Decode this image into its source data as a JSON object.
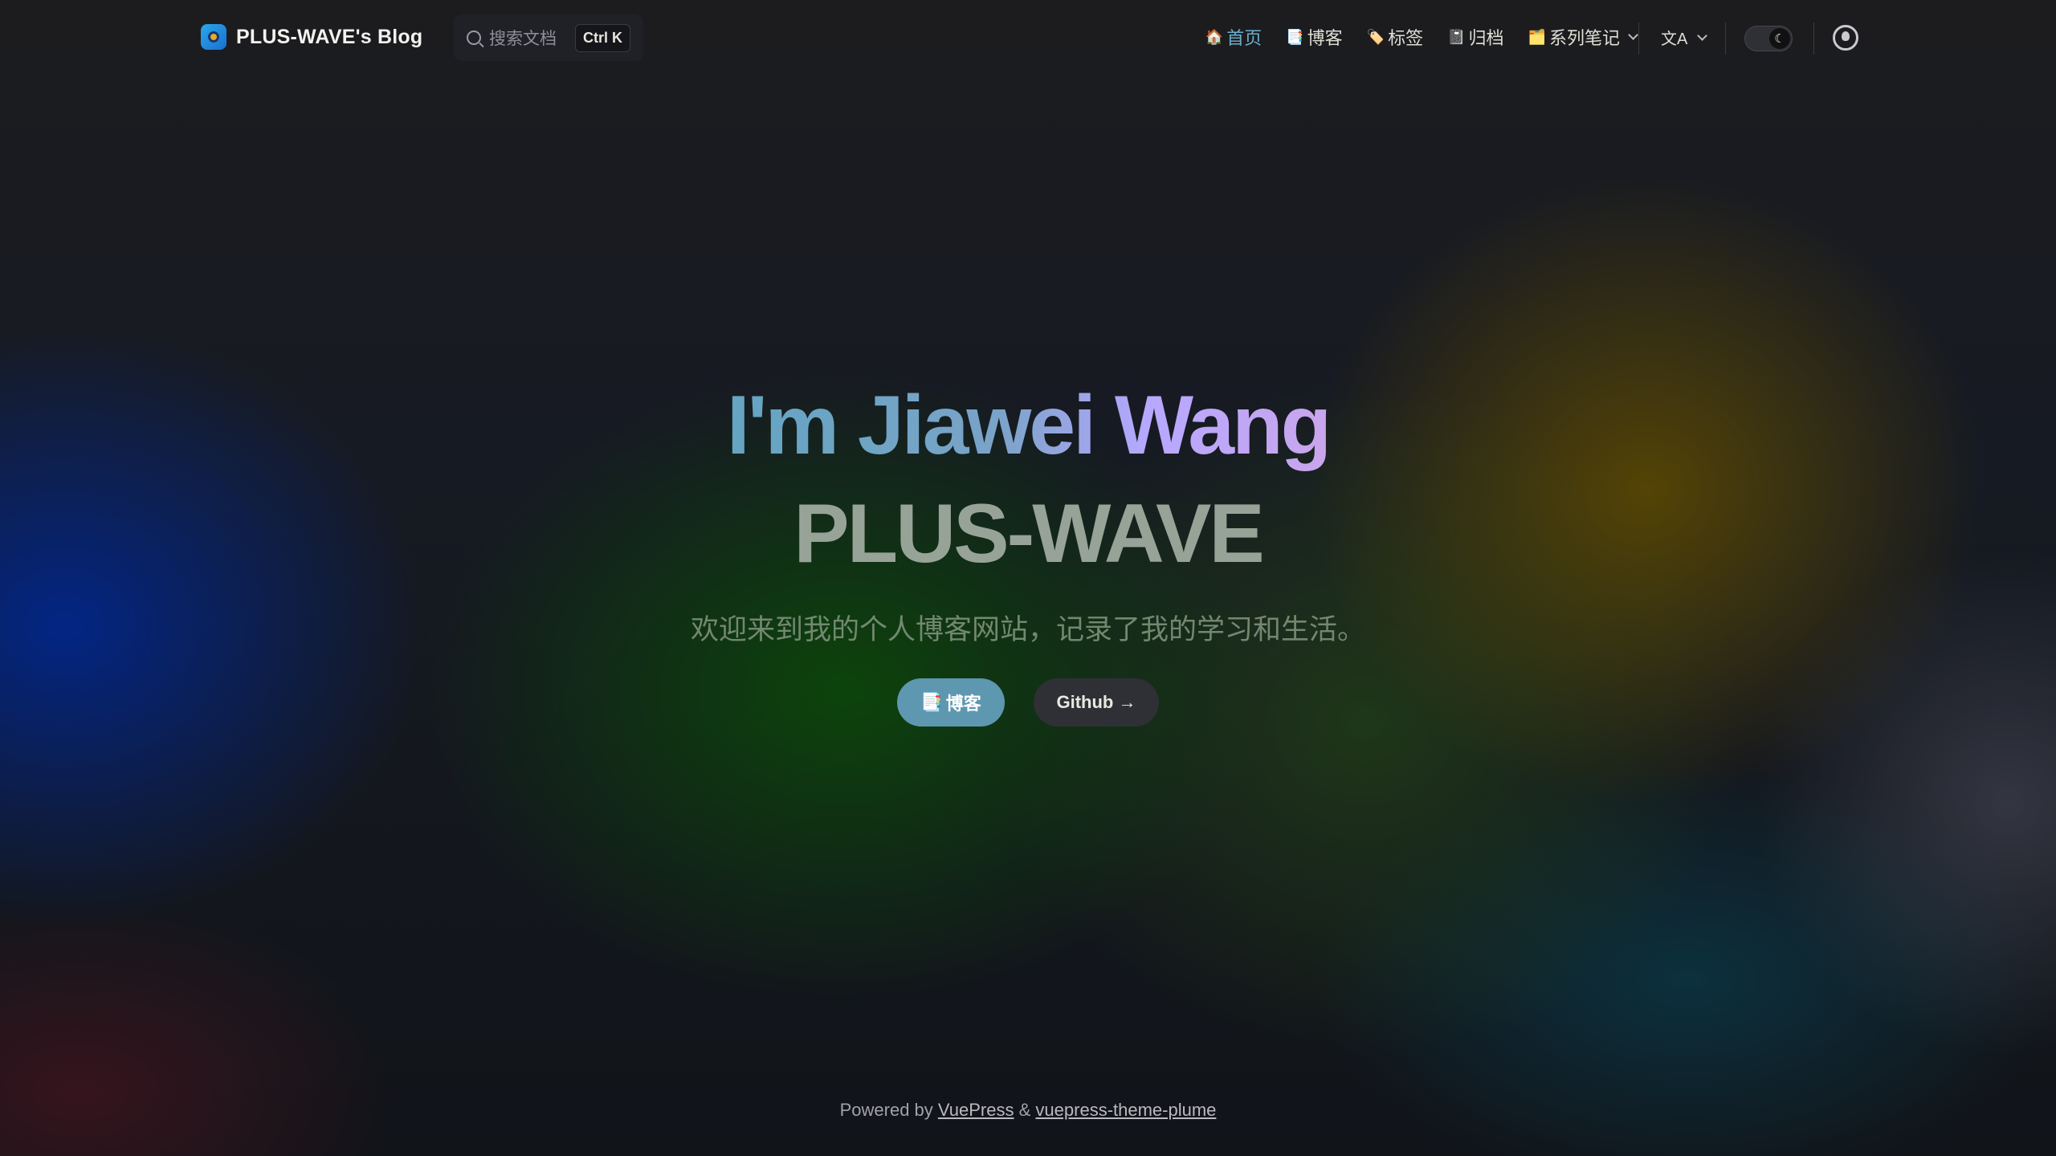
{
  "nav": {
    "brand_text": "PLUS-WAVE's Blog",
    "search": {
      "placeholder": "搜索文档",
      "shortcut": "Ctrl K"
    },
    "menu": [
      {
        "icon": "🏠",
        "label": "首页",
        "active": true
      },
      {
        "icon": "📑",
        "label": "博客",
        "active": false
      },
      {
        "icon": "🏷️",
        "label": "标签",
        "active": false
      },
      {
        "icon": "📓",
        "label": "归档",
        "active": false
      },
      {
        "icon": "🗂️",
        "label": "系列笔记",
        "active": false,
        "dropdown": true
      }
    ],
    "translate_icon": "文A",
    "theme_icon": "☾"
  },
  "hero": {
    "name": "I'm Jiawei Wang",
    "text": "PLUS-WAVE",
    "tagline": "欢迎来到我的个人博客网站，记录了我的学习和生活。",
    "actions": [
      {
        "icon": "📑",
        "label": "博客"
      },
      {
        "label": "Github →"
      }
    ]
  },
  "footer": {
    "prefix": "Powered by",
    "link1": "VuePress",
    "amp": "&",
    "link2": "vuepress-theme-plume"
  },
  "colors": {
    "accent": "#5e97b0",
    "active_link": "#6ab0cf",
    "bg": "#1b1b1f"
  }
}
